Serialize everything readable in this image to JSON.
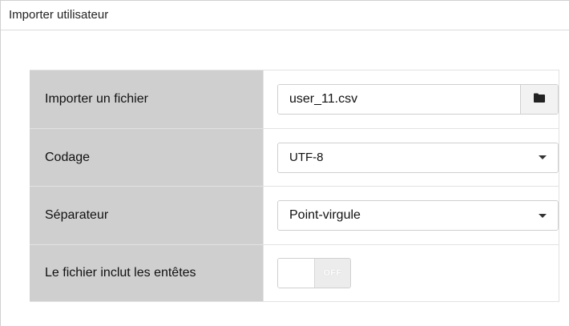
{
  "panel": {
    "title": "Importer utilisateur"
  },
  "form": {
    "file": {
      "label": "Importer un fichier",
      "value": "user_11.csv",
      "browse_icon": "folder-icon"
    },
    "encoding": {
      "label": "Codage",
      "value": "UTF-8",
      "icon": "caret-down-icon"
    },
    "separator": {
      "label": "Séparateur",
      "value": "Point-virgule",
      "icon": "caret-down-icon"
    },
    "headers": {
      "label": "Le fichier inclut les entêtes",
      "toggle_state": "OFF"
    }
  }
}
